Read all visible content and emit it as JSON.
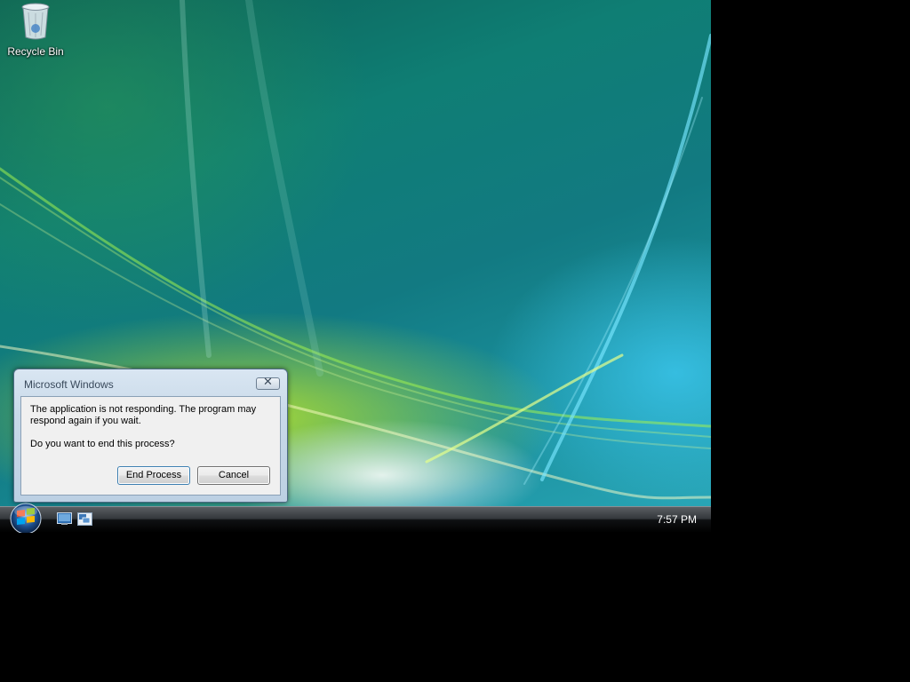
{
  "desktop": {
    "icons": [
      {
        "label": "Recycle Bin",
        "icon": "recycle-bin-icon"
      }
    ]
  },
  "dialog": {
    "title": "Microsoft Windows",
    "message": "The application is not responding. The program may respond again if you wait.",
    "question": "Do you want to end this process?",
    "buttons": {
      "end_process": "End Process",
      "cancel": "Cancel"
    },
    "close_icon": "close-icon"
  },
  "taskbar": {
    "start_icon": "windows-start-orb-icon",
    "quick_launch": [
      {
        "icon": "show-desktop-icon"
      },
      {
        "icon": "switch-windows-icon"
      }
    ],
    "clock": "7:57 PM"
  },
  "colors": {
    "taskbar": "#000000",
    "dialog_frame": "#c8d9e9",
    "dialog_client": "#f0f0f0",
    "accent_button_border": "#3c7fb1"
  }
}
